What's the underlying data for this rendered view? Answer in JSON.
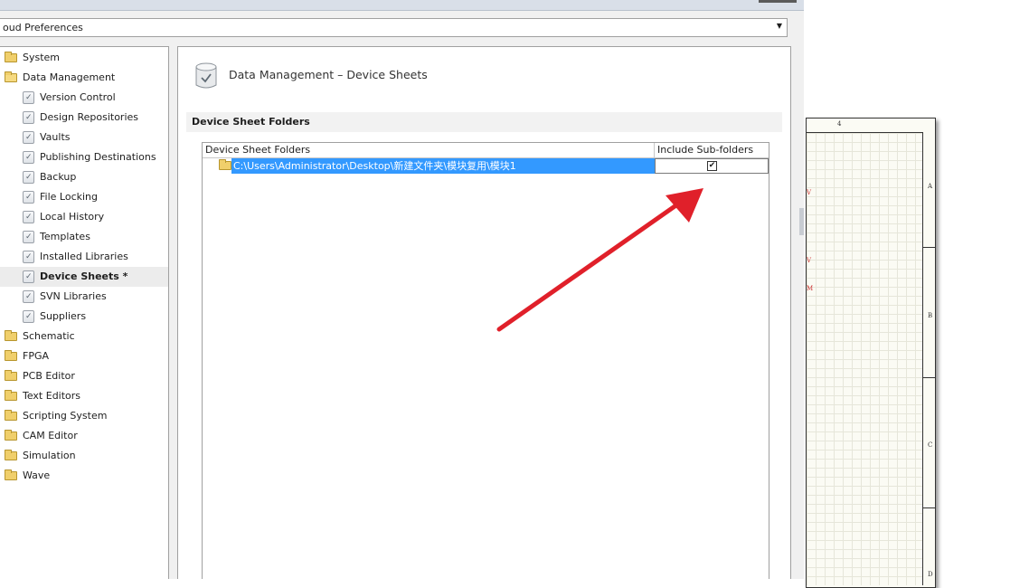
{
  "dialog": {
    "preferences_combo": "oud Preferences"
  },
  "tree": {
    "items": [
      {
        "label": "System",
        "icon": "folder-icon"
      },
      {
        "label": "Data Management",
        "icon": "folder-open-icon"
      },
      {
        "label": "Version Control",
        "icon": "page-check-icon"
      },
      {
        "label": "Design Repositories",
        "icon": "page-check-icon"
      },
      {
        "label": "Vaults",
        "icon": "page-check-icon"
      },
      {
        "label": "Publishing Destinations",
        "icon": "page-check-icon"
      },
      {
        "label": "Backup",
        "icon": "page-check-icon"
      },
      {
        "label": "File Locking",
        "icon": "page-check-icon"
      },
      {
        "label": "Local History",
        "icon": "page-check-icon"
      },
      {
        "label": "Templates",
        "icon": "page-check-icon"
      },
      {
        "label": "Installed Libraries",
        "icon": "page-check-icon"
      },
      {
        "label": "Device Sheets *",
        "icon": "page-check-icon",
        "selected": true
      },
      {
        "label": "SVN Libraries",
        "icon": "page-check-icon"
      },
      {
        "label": "Suppliers",
        "icon": "page-check-icon"
      },
      {
        "label": "Schematic",
        "icon": "folder-icon"
      },
      {
        "label": "FPGA",
        "icon": "folder-icon"
      },
      {
        "label": "PCB Editor",
        "icon": "folder-icon"
      },
      {
        "label": "Text Editors",
        "icon": "folder-icon"
      },
      {
        "label": "Scripting System",
        "icon": "folder-icon"
      },
      {
        "label": "CAM Editor",
        "icon": "folder-icon"
      },
      {
        "label": "Simulation",
        "icon": "folder-icon"
      },
      {
        "label": "Wave",
        "icon": "folder-icon"
      }
    ]
  },
  "panel": {
    "title": "Data Management – Device Sheets",
    "section_header": "Device Sheet Folders",
    "grid": {
      "columns": [
        "Device Sheet Folders",
        "Include Sub-folders"
      ],
      "rows": [
        {
          "path": "C:\\Users\\Administrator\\Desktop\\新建文件夹\\模块复用\\模块1",
          "include_subfolders": true,
          "check_glyph": "✔"
        }
      ]
    }
  },
  "schematic": {
    "top_label": "4",
    "zones": [
      "A",
      "B",
      "C",
      "D"
    ],
    "marks": [
      "V",
      "V",
      "M"
    ]
  },
  "colors": {
    "selection": "#3399ff",
    "arrow": "#e0202a",
    "dialog_bg": "#f0f0f0"
  }
}
